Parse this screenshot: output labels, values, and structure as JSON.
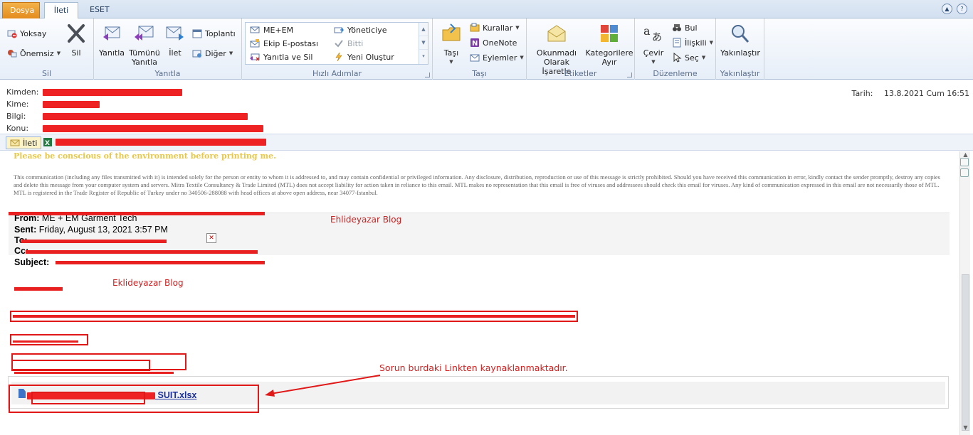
{
  "tabs": {
    "file": "Dosya",
    "message": "İleti",
    "eset": "ESET"
  },
  "ribbon": {
    "sil_group": {
      "ignore": "Yoksay",
      "junk": "Önemsiz",
      "delete": "Sil",
      "label": "Sil"
    },
    "reply_group": {
      "reply": "Yanıtla",
      "reply_all_1": "Tümünü",
      "reply_all_2": "Yanıtla",
      "forward": "İlet",
      "meeting": "Toplantı",
      "more": "Diğer",
      "label": "Yanıtla"
    },
    "quick_steps": {
      "items": [
        "ME+EM",
        "Ekip E-postası",
        "Yanıtla ve Sil",
        "Yöneticiye",
        "Bitti",
        "Yeni Oluştur"
      ],
      "label": "Hızlı Adımlar"
    },
    "move_group": {
      "move": "Taşı",
      "rules": "Kurallar",
      "onenote": "OneNote",
      "actions": "Eylemler",
      "label": "Taşı"
    },
    "tags_group": {
      "unread_1": "Okunmadı",
      "unread_2": "Olarak İşaretle",
      "categorize_1": "Kategorilere",
      "categorize_2": "Ayır",
      "label": "Etiketler"
    },
    "edit_group": {
      "translate": "Çevir",
      "find": "Bul",
      "related": "İlişkili",
      "select": "Seç",
      "label": "Düzenleme"
    },
    "zoom_group": {
      "zoom": "Yakınlaştır",
      "label": "Yakınlaştır"
    }
  },
  "header": {
    "from_label": "Kimden:",
    "to_label": "Kime:",
    "cc_label": "Bilgi:",
    "subject_label": "Konu:",
    "date_label": "Tarih:",
    "date_value": "13.8.2021 Cum 16:51"
  },
  "attachments_bar": {
    "message_tab": "İleti"
  },
  "body": {
    "env_note": "Please be conscious of the environment before printing me.",
    "disclaimer": "This communication (including any files transmitted with it) is intended solely for the person or entity to whom it is addressed to, and may contain confidential or privileged information. Any disclosure, distribution, reproduction or use of this message is strictly prohibited. Should you have received this communication in error, kindly contact the sender promptly, destroy any copies and delete this message from your computer system and servers. Mitra Textile Consultancy & Trade Limited (MTL) does not accept liability for action taken in reliance to this email. MTL makes no representation that this email is free of viruses and addressees should check this email for viruses. Any kind of communication expressed in this email are not necessarily those of MTL. MTL is registered in the Trade Register of Republic of Turkey under no 340506-288088 with head offices at above open address, near 34077-Istanbul.",
    "from_line_label": "From:",
    "from_line_value": "ME + EM Garment Tech",
    "sent_label": "Sent:",
    "sent_value": "Friday, August 13, 2021 3:57 PM",
    "to_line_label": "To:",
    "cc_line_label": "Cc:",
    "subject_line_label": "Subject:",
    "watermark_1": "Ehlideyazar Blog",
    "watermark_2": "Eklideyazar Blog",
    "attachment_link": "SUIT.xlsx",
    "callout": "Sorun burdaki Linkten kaynaklanmaktadır."
  }
}
